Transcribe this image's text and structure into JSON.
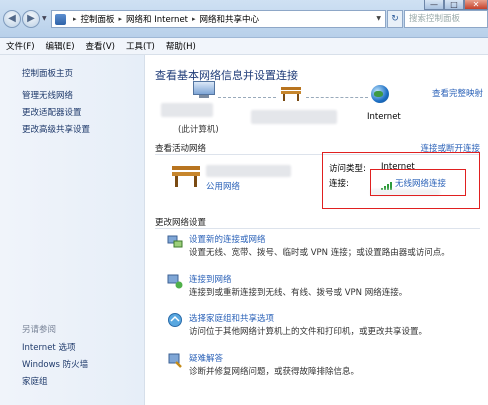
{
  "address_bar": {
    "crumbs": [
      "控制面板",
      "网络和 Internet",
      "网络和共享中心"
    ],
    "search_placeholder": "搜索控制面板"
  },
  "window_controls": {
    "min": "—",
    "max": "□",
    "close": "✕"
  },
  "menu": [
    "文件(F)",
    "编辑(E)",
    "查看(V)",
    "工具(T)",
    "帮助(H)"
  ],
  "sidebar": {
    "home": "控制面板主页",
    "links": [
      "管理无线网络",
      "更改适配器设置",
      "更改高级共享设置"
    ],
    "see_also_title": "另请参阅",
    "see_also": [
      "Internet 选项",
      "Windows 防火墙",
      "家庭组"
    ]
  },
  "main": {
    "title": "查看基本网络信息并设置连接",
    "full_map": "查看完整映射",
    "computer_label": "(此计算机)",
    "internet_label": "Internet",
    "active_title": "查看活动网络",
    "connect_link": "连接或断开连接",
    "network_type": "公用网络",
    "access_type_key": "访问类型:",
    "access_type_value": "Internet",
    "connection_key": "连接:",
    "connection_value": "无线网络连接",
    "change_title": "更改网络设置",
    "tasks": [
      {
        "icon": "network-setup-icon",
        "title": "设置新的连接或网络",
        "desc": "设置无线、宽带、拨号、临时或 VPN 连接；或设置路由器或访问点。"
      },
      {
        "icon": "connect-network-icon",
        "title": "连接到网络",
        "desc": "连接到或重新连接到无线、有线、拨号或 VPN 网络连接。"
      },
      {
        "icon": "homegroup-icon",
        "title": "选择家庭组和共享选项",
        "desc": "访问位于其他网络计算机上的文件和打印机，或更改共享设置。"
      },
      {
        "icon": "troubleshoot-icon",
        "title": "疑难解答",
        "desc": "诊断并修复网络问题，或获得故障排除信息。"
      }
    ]
  },
  "colors": {
    "link": "#2b62b8",
    "title": "#1e3b78",
    "highlight": "#e02020"
  }
}
